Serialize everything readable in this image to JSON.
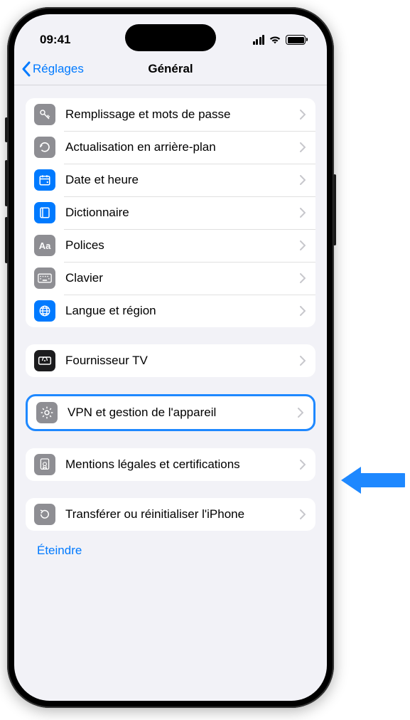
{
  "status": {
    "time": "09:41"
  },
  "nav": {
    "back_label": "Réglages",
    "title": "Général"
  },
  "group1": [
    {
      "id": "autofill",
      "label": "Remplissage et mots de passe",
      "icon": "key",
      "color": "gray"
    },
    {
      "id": "background-refresh",
      "label": "Actualisation en arrière-plan",
      "icon": "refresh",
      "color": "gray"
    },
    {
      "id": "date-time",
      "label": "Date et heure",
      "icon": "calendar",
      "color": "blue"
    },
    {
      "id": "dictionary",
      "label": "Dictionnaire",
      "icon": "book",
      "color": "blue"
    },
    {
      "id": "fonts",
      "label": "Polices",
      "icon": "aa",
      "color": "gray"
    },
    {
      "id": "keyboard",
      "label": "Clavier",
      "icon": "keyboard",
      "color": "gray"
    },
    {
      "id": "language",
      "label": "Langue et région",
      "icon": "globe",
      "color": "blue"
    }
  ],
  "group2": [
    {
      "id": "tv-provider",
      "label": "Fournisseur TV",
      "icon": "tv",
      "color": "black"
    }
  ],
  "group3": [
    {
      "id": "vpn",
      "label": "VPN et gestion de l'appareil",
      "icon": "gear",
      "color": "gray"
    }
  ],
  "group4": [
    {
      "id": "legal",
      "label": "Mentions légales et certifications",
      "icon": "cert",
      "color": "gray"
    }
  ],
  "group5": [
    {
      "id": "transfer-reset",
      "label": "Transférer ou réinitialiser l'iPhone",
      "icon": "reset",
      "color": "gray"
    }
  ],
  "footer": {
    "shutdown": "Éteindre"
  }
}
